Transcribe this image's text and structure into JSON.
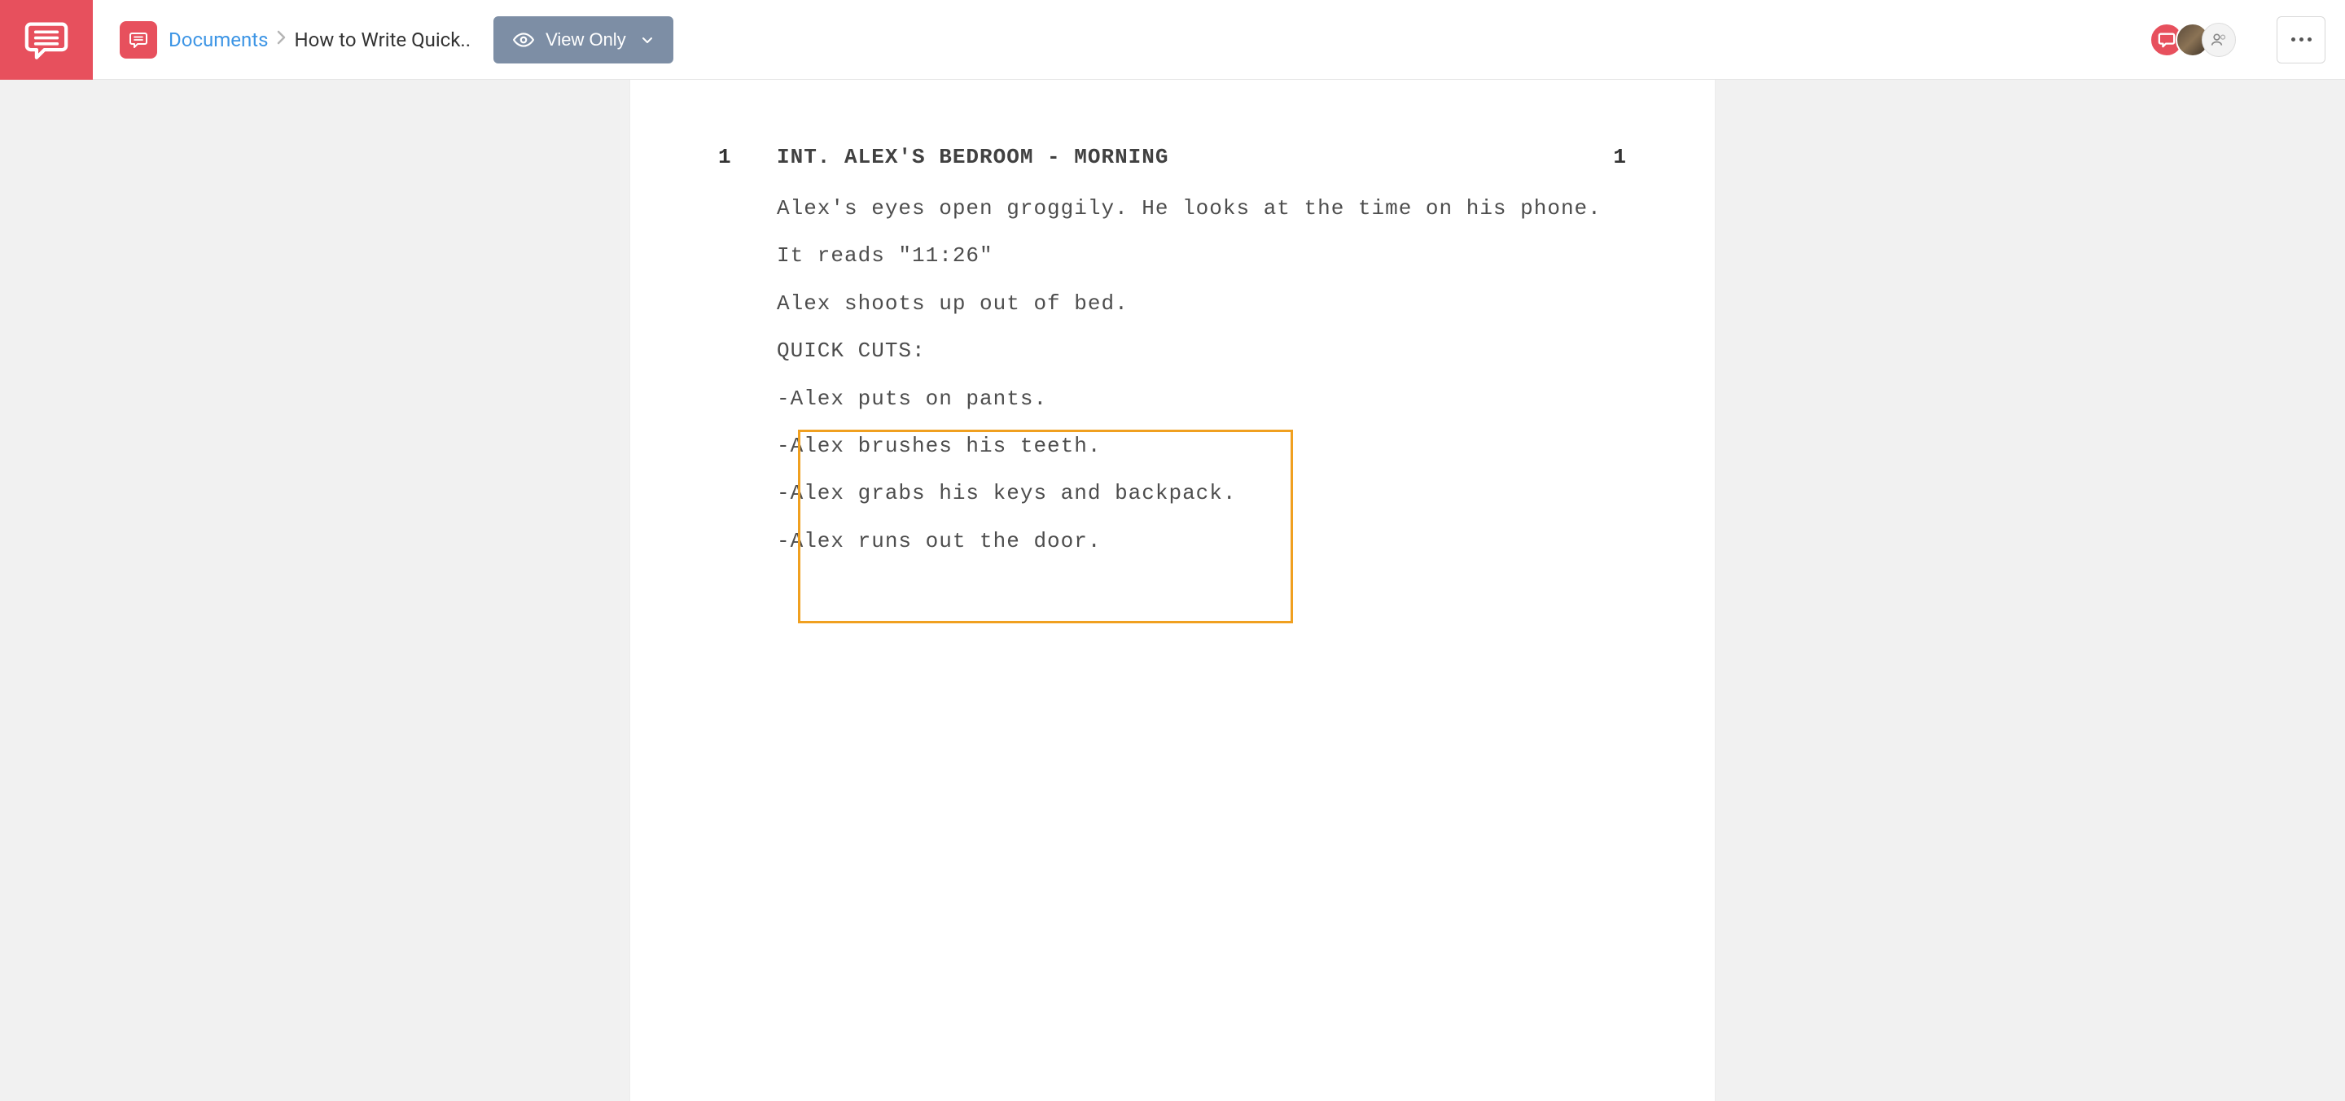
{
  "header": {
    "breadcrumb_root": "Documents",
    "breadcrumb_current": "How to Write Quick..",
    "view_button_label": "View Only"
  },
  "scene": {
    "number_left": "1",
    "heading": "INT. ALEX'S BEDROOM - MORNING",
    "number_right": "1",
    "lines": [
      "Alex's eyes open groggily. He looks at the time on his phone.",
      "It reads \"11:26\"",
      "Alex shoots up out of bed.",
      "QUICK CUTS:",
      "-Alex puts on pants.",
      "-Alex brushes his teeth.",
      "-Alex grabs his keys and backpack.",
      "-Alex runs out the door."
    ]
  }
}
